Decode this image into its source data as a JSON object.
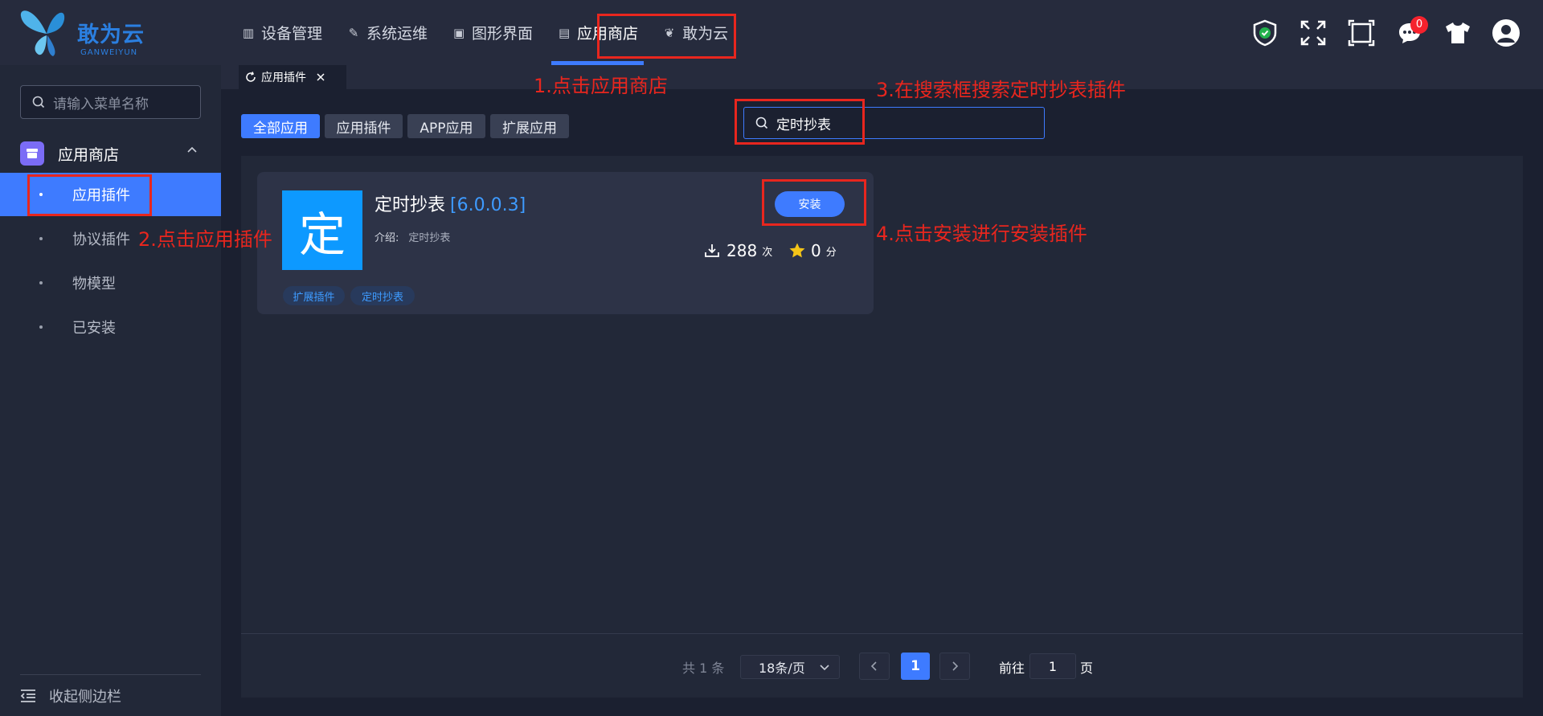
{
  "brand": {
    "name": "敢为云",
    "sub": "GANWEIYUN"
  },
  "nav": [
    {
      "label": "设备管理"
    },
    {
      "label": "系统运维"
    },
    {
      "label": "图形界面"
    },
    {
      "label": "应用商店"
    },
    {
      "label": "敢为云"
    }
  ],
  "toolbar": {
    "message_count": "0"
  },
  "sidebar": {
    "search_placeholder": "请输入菜单名称",
    "group_label": "应用商店",
    "items": [
      {
        "label": "应用插件"
      },
      {
        "label": "协议插件"
      },
      {
        "label": "物模型"
      },
      {
        "label": "已安装"
      }
    ],
    "collapse_label": "收起侧边栏"
  },
  "tabs": [
    {
      "label": "应用插件"
    }
  ],
  "filters": [
    {
      "label": "全部应用"
    },
    {
      "label": "应用插件"
    },
    {
      "label": "APP应用"
    },
    {
      "label": "扩展应用"
    }
  ],
  "search": {
    "value": "定时抄表"
  },
  "app": {
    "icon_char": "定",
    "name": "定时抄表",
    "version": "[6.0.0.3]",
    "intro_label": "介绍:",
    "intro_value": "定时抄表",
    "install_label": "安装",
    "downloads": "288",
    "downloads_unit": "次",
    "rating": "0",
    "rating_unit": "分",
    "tags": [
      "扩展插件",
      "定时抄表"
    ]
  },
  "pagination": {
    "total_text": "共 1 条",
    "page_size": "18条/页",
    "current_page": "1",
    "goto_label": "前往",
    "goto_value": "1",
    "goto_unit": "页"
  },
  "annotations": {
    "step1": "1.点击应用商店",
    "step2": "2.点击应用插件",
    "step3": "3.在搜索框搜索定时抄表插件",
    "step4": "4.点击安装进行安装插件"
  },
  "colors": {
    "accent": "#3e7bff",
    "annotation": "#e8261e",
    "app_icon": "#0d99ff"
  }
}
